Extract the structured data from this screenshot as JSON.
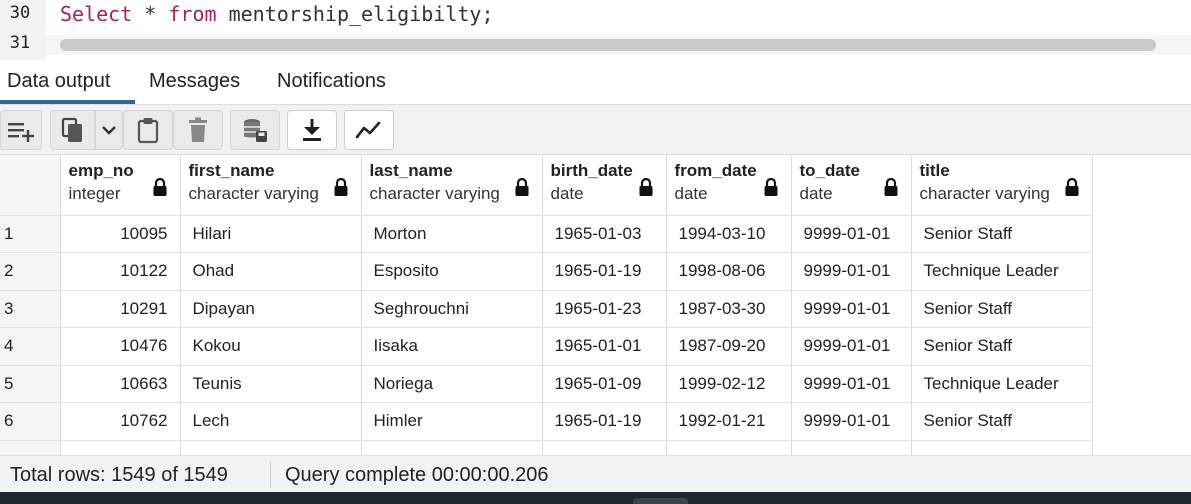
{
  "editor": {
    "line_numbers": [
      "30",
      "31"
    ],
    "code": {
      "kw_select": "Select",
      "star": " * ",
      "kw_from": "from",
      "rest": " mentorship_eligibilty;"
    }
  },
  "tabs": [
    {
      "label": "Data output",
      "active": true
    },
    {
      "label": "Messages",
      "active": false
    },
    {
      "label": "Notifications",
      "active": false
    }
  ],
  "toolbar": {
    "icons": [
      "add-row-icon",
      "copy-icon",
      "chevron-down-icon",
      "paste-icon",
      "delete-icon",
      "save-data-icon",
      "download-icon",
      "graph-icon"
    ]
  },
  "grid": {
    "columns": [
      {
        "name": "emp_no",
        "type": "integer"
      },
      {
        "name": "first_name",
        "type": "character varying"
      },
      {
        "name": "last_name",
        "type": "character varying"
      },
      {
        "name": "birth_date",
        "type": "date"
      },
      {
        "name": "from_date",
        "type": "date"
      },
      {
        "name": "to_date",
        "type": "date"
      },
      {
        "name": "title",
        "type": "character varying"
      }
    ],
    "rows": [
      {
        "n": "1",
        "emp_no": "10095",
        "first_name": "Hilari",
        "last_name": "Morton",
        "birth_date": "1965-01-03",
        "from_date": "1994-03-10",
        "to_date": "9999-01-01",
        "title": "Senior Staff"
      },
      {
        "n": "2",
        "emp_no": "10122",
        "first_name": "Ohad",
        "last_name": "Esposito",
        "birth_date": "1965-01-19",
        "from_date": "1998-08-06",
        "to_date": "9999-01-01",
        "title": "Technique Leader"
      },
      {
        "n": "3",
        "emp_no": "10291",
        "first_name": "Dipayan",
        "last_name": "Seghrouchni",
        "birth_date": "1965-01-23",
        "from_date": "1987-03-30",
        "to_date": "9999-01-01",
        "title": "Senior Staff"
      },
      {
        "n": "4",
        "emp_no": "10476",
        "first_name": "Kokou",
        "last_name": "Iisaka",
        "birth_date": "1965-01-01",
        "from_date": "1987-09-20",
        "to_date": "9999-01-01",
        "title": "Senior Staff"
      },
      {
        "n": "5",
        "emp_no": "10663",
        "first_name": "Teunis",
        "last_name": "Noriega",
        "birth_date": "1965-01-09",
        "from_date": "1999-02-12",
        "to_date": "9999-01-01",
        "title": "Technique Leader"
      },
      {
        "n": "6",
        "emp_no": "10762",
        "first_name": "Lech",
        "last_name": "Himler",
        "birth_date": "1965-01-19",
        "from_date": "1992-01-21",
        "to_date": "9999-01-01",
        "title": "Senior Staff"
      }
    ]
  },
  "status": {
    "total_rows": "Total rows: 1549 of 1549",
    "query": "Query complete 00:00:00.206"
  }
}
